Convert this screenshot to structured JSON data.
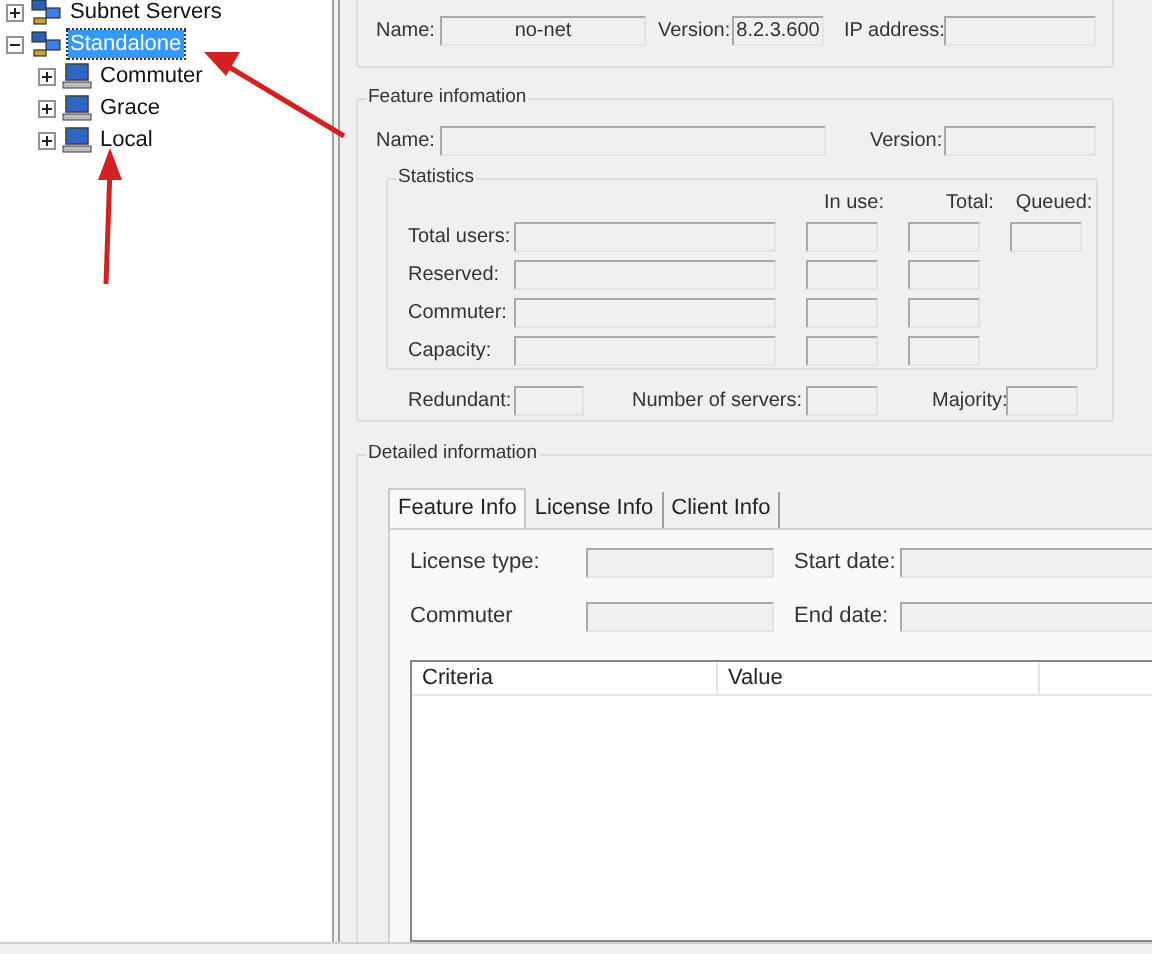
{
  "tree": [
    {
      "label": "Subnet Servers",
      "kind": "network",
      "expanded": false,
      "selected": false
    },
    {
      "label": "Standalone",
      "kind": "network",
      "expanded": true,
      "selected": true,
      "children": [
        {
          "label": "Commuter",
          "kind": "computer",
          "expanded": false,
          "selected": false
        },
        {
          "label": "Grace",
          "kind": "computer",
          "expanded": false,
          "selected": false
        },
        {
          "label": "Local",
          "kind": "computer",
          "expanded": false,
          "selected": false
        }
      ]
    }
  ],
  "server_information": {
    "name_label": "Name:",
    "name": "no-net",
    "version_label": "Version:",
    "version": "8.2.3.600",
    "ip_label": "IP address:"
  },
  "feature_information": {
    "title": "Feature infomation",
    "name_label": "Name:",
    "version_label": "Version:",
    "statistics": {
      "title": "Statistics",
      "columns": [
        "In use:",
        "Total:",
        "Queued:"
      ],
      "rows": [
        {
          "label": "Total users:",
          "queued": true
        },
        {
          "label": "Reserved:",
          "queued": false
        },
        {
          "label": "Commuter:",
          "queued": false
        },
        {
          "label": "Capacity:",
          "queued": false
        }
      ]
    },
    "redundant_label": "Redundant:",
    "servers_label": "Number of servers:",
    "majority_label": "Majority:"
  },
  "detailed_information": {
    "title": "Detailed information",
    "tabs": [
      {
        "label": "Feature Info",
        "selected": true
      },
      {
        "label": "License Info",
        "selected": false
      },
      {
        "label": "Client Info",
        "selected": false
      }
    ],
    "license_type_label": "License type:",
    "start_date_label": "Start date:",
    "commuter_label": "Commuter",
    "end_date_label": "End date:",
    "table": {
      "columns": [
        "Criteria",
        "Value"
      ]
    }
  }
}
